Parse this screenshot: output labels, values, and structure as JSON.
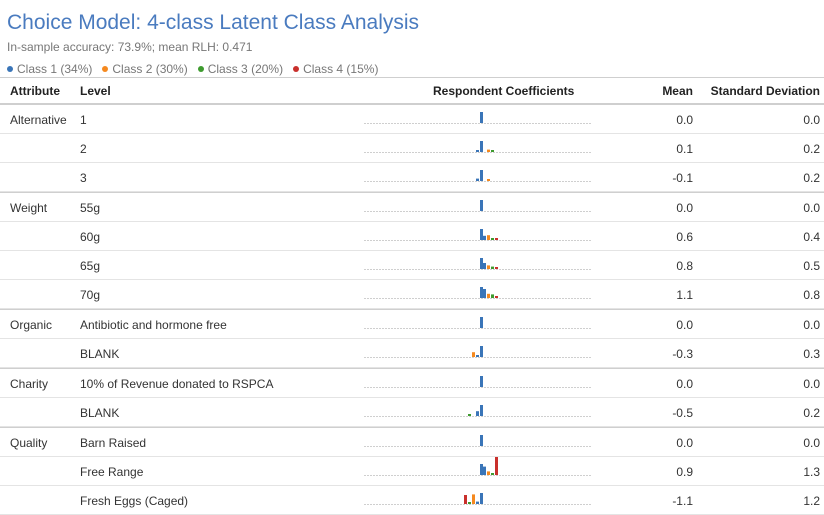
{
  "title": "Choice Model: 4-class Latent Class Analysis",
  "subtitle": "In-sample accuracy: 73.9%; mean RLH: 0.471",
  "legend": [
    {
      "label": "Class 1 (34%)",
      "color": "#3a75b8"
    },
    {
      "label": "Class 2 (30%)",
      "color": "#f5891f"
    },
    {
      "label": "Class 3 (20%)",
      "color": "#3e9b2f"
    },
    {
      "label": "Class 4 (15%)",
      "color": "#c9302c"
    }
  ],
  "columns": {
    "attribute": "Attribute",
    "level": "Level",
    "coefficients": "Respondent Coefficients",
    "mean": "Mean",
    "sd": "Standard Deviation"
  },
  "chart_data": {
    "type": "table",
    "classes": [
      "Class 1 (34%)",
      "Class 2 (30%)",
      "Class 3 (20%)",
      "Class 4 (15%)"
    ],
    "rows": [
      {
        "attribute": "Alternative",
        "level": "1",
        "mean": "0.0",
        "sd": "0.0",
        "coefs": [
          0.0,
          0.0,
          0.0,
          0.0
        ]
      },
      {
        "attribute": "",
        "level": "2",
        "mean": "0.1",
        "sd": "0.2",
        "coefs": [
          -0.2,
          0.4,
          0.1,
          0.0
        ]
      },
      {
        "attribute": "",
        "level": "3",
        "mean": "-0.1",
        "sd": "0.2",
        "coefs": [
          -0.4,
          0.3,
          0.0,
          0.0
        ]
      },
      {
        "attribute": "Weight",
        "level": "55g",
        "mean": "0.0",
        "sd": "0.0",
        "coefs": [
          0.0,
          0.0,
          0.0,
          0.0
        ]
      },
      {
        "attribute": "",
        "level": "60g",
        "mean": "0.6",
        "sd": "0.4",
        "coefs": [
          0.7,
          0.8,
          0.2,
          0.3
        ]
      },
      {
        "attribute": "",
        "level": "65g",
        "mean": "0.8",
        "sd": "0.5",
        "coefs": [
          1.0,
          0.6,
          0.4,
          0.3
        ]
      },
      {
        "attribute": "",
        "level": "70g",
        "mean": "1.1",
        "sd": "0.8",
        "coefs": [
          1.5,
          0.7,
          0.6,
          0.3
        ]
      },
      {
        "attribute": "Organic",
        "level": "Antibiotic and hormone free",
        "mean": "0.0",
        "sd": "0.0",
        "coefs": [
          0.0,
          0.0,
          0.0,
          0.0
        ]
      },
      {
        "attribute": "",
        "level": "BLANK",
        "mean": "-0.3",
        "sd": "0.3",
        "coefs": [
          -0.1,
          -0.8,
          0.0,
          0.0
        ]
      },
      {
        "attribute": "Charity",
        "level": "10% of Revenue donated to RSPCA",
        "mean": "0.0",
        "sd": "0.0",
        "coefs": [
          0.0,
          0.0,
          0.0,
          0.0
        ]
      },
      {
        "attribute": "",
        "level": "BLANK",
        "mean": "-0.5",
        "sd": "0.2",
        "coefs": [
          -0.8,
          0.0,
          -0.3,
          0.0
        ]
      },
      {
        "attribute": "Quality",
        "level": "Barn Raised",
        "mean": "0.0",
        "sd": "0.0",
        "coefs": [
          0.0,
          0.0,
          0.0,
          0.0
        ]
      },
      {
        "attribute": "",
        "level": "Free Range",
        "mean": "0.9",
        "sd": "1.3",
        "coefs": [
          1.4,
          0.6,
          0.3,
          3.5
        ]
      },
      {
        "attribute": "",
        "level": "Fresh Eggs (Caged)",
        "mean": "-1.1",
        "sd": "1.2",
        "coefs": [
          -0.4,
          -1.6,
          -0.3,
          -1.5
        ]
      }
    ]
  }
}
